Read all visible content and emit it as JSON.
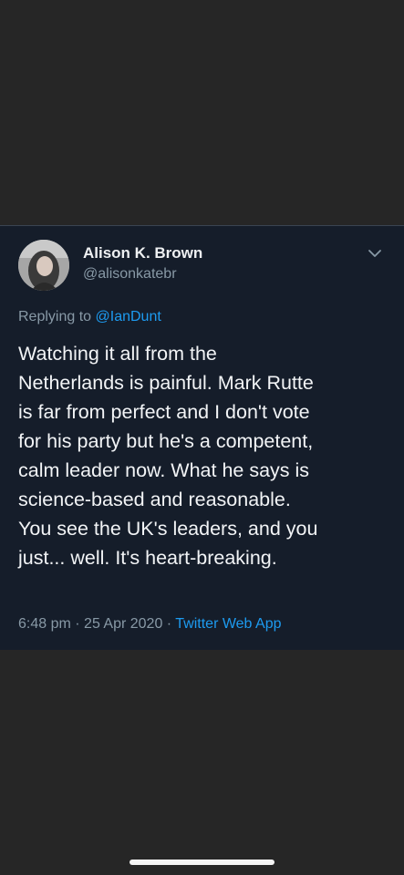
{
  "tweet": {
    "display_name": "Alison K. Brown",
    "handle": "@alisonkatebr",
    "replying_prefix": "Replying to",
    "replying_to": "@IanDunt",
    "text_lines": [
      "Watching it all from the",
      "Netherlands is painful. Mark Rutte",
      "is far from perfect and I don't vote",
      "for his party but he's a competent,",
      "calm leader now. What he says is",
      "science-based and reasonable.",
      "You see the UK's leaders, and you",
      "just... well. It's heart-breaking."
    ],
    "time": "6:48 pm",
    "date": "25 Apr 2020",
    "source": "Twitter Web App",
    "separator": "·"
  },
  "icons": {
    "menu": "chevron-down-icon",
    "avatar": "avatar"
  },
  "colors": {
    "background": "#262626",
    "card": "#151d2a",
    "link": "#1d9bf0",
    "secondary_text": "#8899a6"
  }
}
